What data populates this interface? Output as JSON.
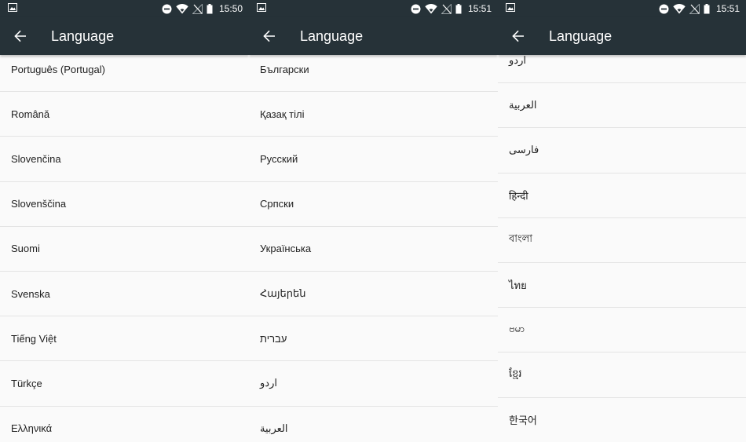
{
  "screens": [
    {
      "time": "15:50",
      "title": "Language",
      "items": [
        "Português (Portugal)",
        "Română",
        "Slovenčina",
        "Slovenščina",
        "Suomi",
        "Svenska",
        "Tiếng Việt",
        "Türkçe",
        "Ελληνικά"
      ]
    },
    {
      "time": "15:51",
      "title": "Language",
      "items": [
        "Български",
        "Қазақ тілі",
        "Русский",
        "Српски",
        "Українська",
        "Հայերեն",
        "עברית",
        "اردو",
        "العربية"
      ]
    },
    {
      "time": "15:51",
      "title": "Language",
      "items": [
        "اردو",
        "العربية",
        "فارسی",
        "हिन्दी",
        "বাংলা",
        "ไทย",
        "ဗမာ",
        "ខ្មែរ",
        "한국어"
      ]
    }
  ],
  "colors": {
    "appbar": "#263238",
    "background": "#fafafa",
    "divider": "#e4e4e4",
    "text": "#212121"
  },
  "icons": [
    "image-notification-icon",
    "do-not-disturb-icon",
    "wifi-icon",
    "no-signal-icon",
    "battery-icon",
    "back-arrow-icon"
  ]
}
